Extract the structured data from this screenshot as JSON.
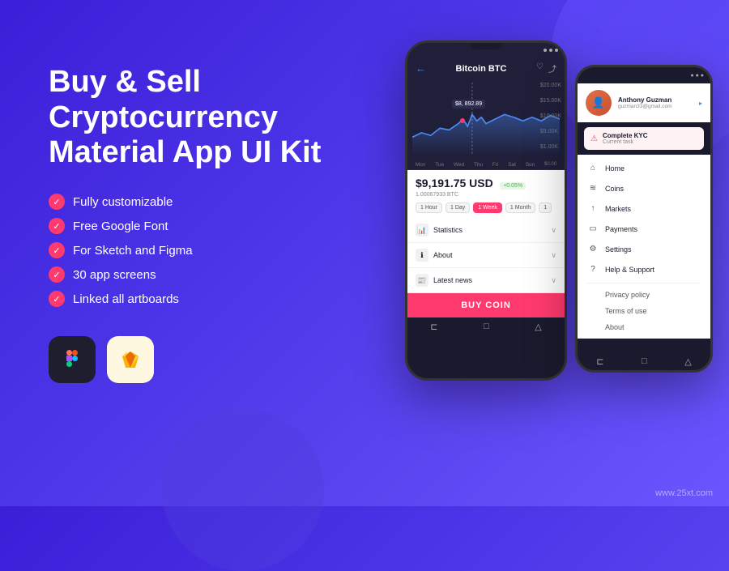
{
  "app": {
    "title": "Buy & Sell Cryptocurrency Material App UI Kit",
    "title_line1": "Buy & Sell",
    "title_line2": "Cryptocurrency",
    "title_line3": "Material App UI Kit"
  },
  "features": [
    "Fully customizable",
    "Free Google Font",
    "For Sketch and Figma",
    "30 app screens",
    "Linked all artboards"
  ],
  "tools": [
    {
      "name": "Figma",
      "icon": "🎨"
    },
    {
      "name": "Sketch",
      "icon": "💎"
    }
  ],
  "phone_main": {
    "header_title": "Bitcoin BTC",
    "price": "$9,191.75 USD",
    "price_btc": "1.00067933 BTC",
    "price_change": "+0.05%",
    "tooltip_price": "$8, 892.89",
    "chart_y_labels": [
      "$20.00K",
      "$15.00K",
      "$10.00K",
      "$5.00K",
      "$1.00K",
      "$0.00"
    ],
    "day_labels": [
      "Mon",
      "Tue",
      "Wed",
      "Thu",
      "Fri",
      "Sat",
      "Sun"
    ],
    "time_buttons": [
      "1 Hour",
      "1 Day",
      "1 Week",
      "1 Month",
      "1"
    ],
    "active_time": "1 Week",
    "menu_items": [
      {
        "label": "Statistics",
        "icon": "📊"
      },
      {
        "label": "About",
        "icon": "ℹ️"
      },
      {
        "label": "Latest news",
        "icon": "📰"
      }
    ],
    "buy_button": "BUY COIN"
  },
  "phone_second": {
    "user_name": "Anthony Guzman",
    "user_email": "guzman33@gmail.com",
    "kyc_title": "Complete KYC",
    "kyc_sub": "Current task",
    "nav_items": [
      {
        "label": "Home",
        "icon": "⌂"
      },
      {
        "label": "Coins",
        "icon": "∿"
      },
      {
        "label": "Markets",
        "icon": "⬆"
      },
      {
        "label": "Payments",
        "icon": "💳"
      },
      {
        "label": "Settings",
        "icon": "⚙"
      },
      {
        "label": "Help & Support",
        "icon": "?"
      }
    ],
    "text_items": [
      "Privacy policy",
      "Terms of use",
      "About"
    ]
  },
  "watermark": "www.25xt.com"
}
